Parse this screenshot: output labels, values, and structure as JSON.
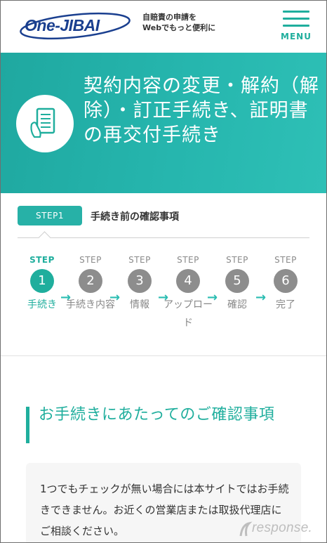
{
  "header": {
    "logo_text": "One-JIBAI",
    "tagline_line1": "自賠責の申請を",
    "tagline_line2": "Webでもっと便利に",
    "menu_label": "MENU"
  },
  "hero": {
    "title": "契約内容の変更・解約（解除）・訂正手続き、証明書の再交付手続き"
  },
  "current_step": {
    "badge": "STEP1",
    "title": "手続き前の確認事項"
  },
  "steps": [
    {
      "word": "STEP",
      "number": "1",
      "label": "手続き",
      "active": true
    },
    {
      "word": "STEP",
      "number": "2",
      "label": "手続き内容",
      "active": false
    },
    {
      "word": "STEP",
      "number": "3",
      "label": "情報",
      "active": false
    },
    {
      "word": "STEP",
      "number": "4",
      "label": "アップロード",
      "active": false
    },
    {
      "word": "STEP",
      "number": "5",
      "label": "確認",
      "active": false
    },
    {
      "word": "STEP",
      "number": "6",
      "label": "完了",
      "active": false
    }
  ],
  "section": {
    "title": "お手続きにあたってのご確認事項"
  },
  "notice": {
    "text": "1つでもチェックが無い場合には本サイトではお手続きできません。お近くの営業店または取扱代理店にご相談ください。"
  },
  "watermark": {
    "text": "response."
  },
  "colors": {
    "accent": "#1fae9d",
    "hero_bg": "#26b6ae",
    "logo_blue": "#1a3f8f",
    "inactive_step": "#8d8d8d"
  },
  "icons": {
    "menu": "hamburger-icon",
    "hero": "document-hand-icon",
    "arrow": "arrow-right-icon"
  }
}
